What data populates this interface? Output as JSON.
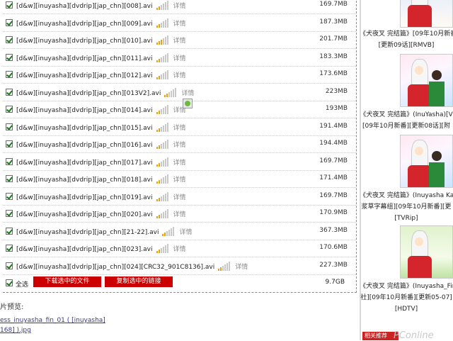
{
  "files": [
    {
      "name": "[d&w][inuyasha][dvdrip][jap_chn][008].avi",
      "detail": "详情",
      "size": "169.7MB"
    },
    {
      "name": "[d&w][inuyasha][dvdrip][jap_chn][009].avi",
      "detail": "详情",
      "size": "187.3MB"
    },
    {
      "name": "[d&w][inuyasha][dvdrip][jap_chn][010].avi",
      "detail": "详情",
      "size": "201.7MB"
    },
    {
      "name": "[d&w][inuyasha][dvdrip][jap_chn][011].avi",
      "detail": "详情",
      "size": "183.3MB"
    },
    {
      "name": "[d&w][inuyasha][dvdrip][jap_chn][012].avi",
      "detail": "详情",
      "size": "173.6MB"
    },
    {
      "name": "[d&w][inuyasha][dvdrip][jap_chn][013V2].avi",
      "detail": "详情",
      "size": "223MB"
    },
    {
      "name": "[d&w][inuyasha][dvdrip][jap_chn][014].avi",
      "detail": "详情",
      "size": "193MB"
    },
    {
      "name": "[d&w][inuyasha][dvdrip][jap_chn][015].avi",
      "detail": "详情",
      "size": "191.4MB"
    },
    {
      "name": "[d&w][inuyasha][dvdrip][jap_chn][016].avi",
      "detail": "详情",
      "size": "194.4MB"
    },
    {
      "name": "[d&w][inuyasha][dvdrip][jap_chn][017].avi",
      "detail": "详情",
      "size": "169.7MB"
    },
    {
      "name": "[d&w][inuyasha][dvdrip][jap_chn][018].avi",
      "detail": "详情",
      "size": "171.4MB"
    },
    {
      "name": "[d&w][inuyasha][dvdrip][jap_chn][019].avi",
      "detail": "详情",
      "size": "169.7MB"
    },
    {
      "name": "[d&w][inuyasha][dvdrip][jap_chn][020].avi",
      "detail": "详情",
      "size": "170.9MB"
    },
    {
      "name": "[d&w][inuyasha][dvdrip][jap_chn][21-22].avi",
      "detail": "详情",
      "size": "367.3MB"
    },
    {
      "name": "[d&w][inuyasha][dvdrip][jap_chn][023].avi",
      "detail": "详情",
      "size": "170.6MB"
    },
    {
      "name": "[d&w][inuyasha][dvdrip][jap_chn][024][CRC32_901C8136].avi",
      "detail": "详情",
      "size": "227.3MB"
    }
  ],
  "selection": {
    "select_all_label": "全选",
    "download_selected": "下载选中的文件",
    "copy_selected_links": "复制选中的链接",
    "total_size": "9.7GB"
  },
  "preview": {
    "title": "片预览:",
    "link_line1": "ess_inuyasha_fin_01 ( [inuyasha]",
    "link_line2": "168] ).jpg"
  },
  "sidebar": {
    "items": [
      {
        "caption_lines": [
          "《犬夜叉 完结篇》[09年10月新番]",
          "[更新09话][RMVB]"
        ]
      },
      {
        "caption_lines": [
          "《犬夜叉 完结篇》(InuYasha)[V",
          "[09年10月新番][更新08话][附"
        ]
      },
      {
        "caption_lines": [
          "《犬夜叉 完结篇》(Inuyasha Kan",
          "浆草字幕组][09年10月新番][更",
          "[TVRip]"
        ]
      },
      {
        "caption_lines": [
          "《犬夜叉 完结篇》(Inuyasha_Fin",
          "社][09年10月新番][更新05-07]",
          "[HDTV]"
        ]
      }
    ],
    "footer_tab": "相关推荐"
  },
  "watermark": "PConline",
  "colors": {
    "button_red": "#cc0000",
    "signal_on": "#e3a21a",
    "checkbox_check": "#1a7a1a"
  }
}
